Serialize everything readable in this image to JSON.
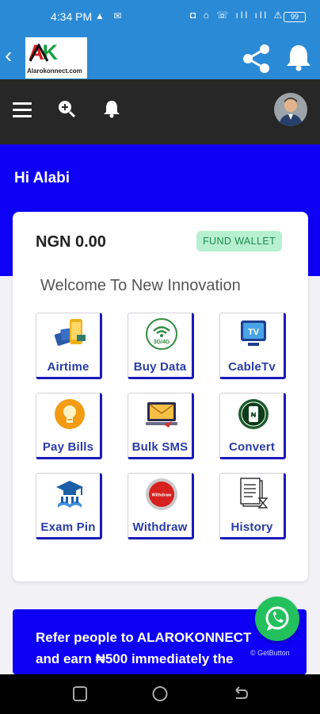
{
  "status_bar": {
    "time": "4:34 PM",
    "battery": "99"
  },
  "app_bar": {
    "back_icon": "chevron-left-icon",
    "logo": {
      "brand": "AK",
      "url": "Alarokonnect.com"
    },
    "share_icon": "share-icon",
    "bell_icon": "bell-icon"
  },
  "nav_bar": {
    "menu_icon": "hamburger-icon",
    "search_icon": "zoom-in-icon",
    "notification_icon": "bell-icon",
    "avatar_icon": "user-avatar"
  },
  "greeting": "Hi Alabi",
  "wallet": {
    "balance": "NGN 0.00",
    "fund_label": "FUND WALLET"
  },
  "welcome": "Welcome To New Innovation",
  "services": [
    {
      "label": "Airtime",
      "icon": "airtime-icon"
    },
    {
      "label": "Buy Data",
      "icon": "data-icon",
      "icon_text": "3G/4G"
    },
    {
      "label": "CableTv",
      "icon": "tv-icon",
      "icon_text": "TV"
    },
    {
      "label": "Pay Bills",
      "icon": "bulb-icon"
    },
    {
      "label": "Bulk SMS",
      "icon": "envelope-icon"
    },
    {
      "label": "Convert",
      "icon": "convert-icon"
    },
    {
      "label": "Exam Pin",
      "icon": "graduation-icon"
    },
    {
      "label": "Withdraw",
      "icon": "withdraw-icon",
      "icon_text": "Withdraw"
    },
    {
      "label": "History",
      "icon": "history-icon"
    }
  ],
  "refer": {
    "line1": "Refer people to ALAROKONNECT",
    "line2": "and earn ₦500 immediately the"
  },
  "whatsapp": {
    "icon": "whatsapp-icon",
    "brand": "GetButton"
  },
  "colors": {
    "primary_blue": "#2b8ad6",
    "hero_blue": "#0d00f5",
    "nav_dark": "#272727",
    "fund_bg": "#b7f0d0",
    "fund_text": "#1c8a52",
    "tile_accent": "#1b19b8",
    "whatsapp": "#22c15e"
  }
}
